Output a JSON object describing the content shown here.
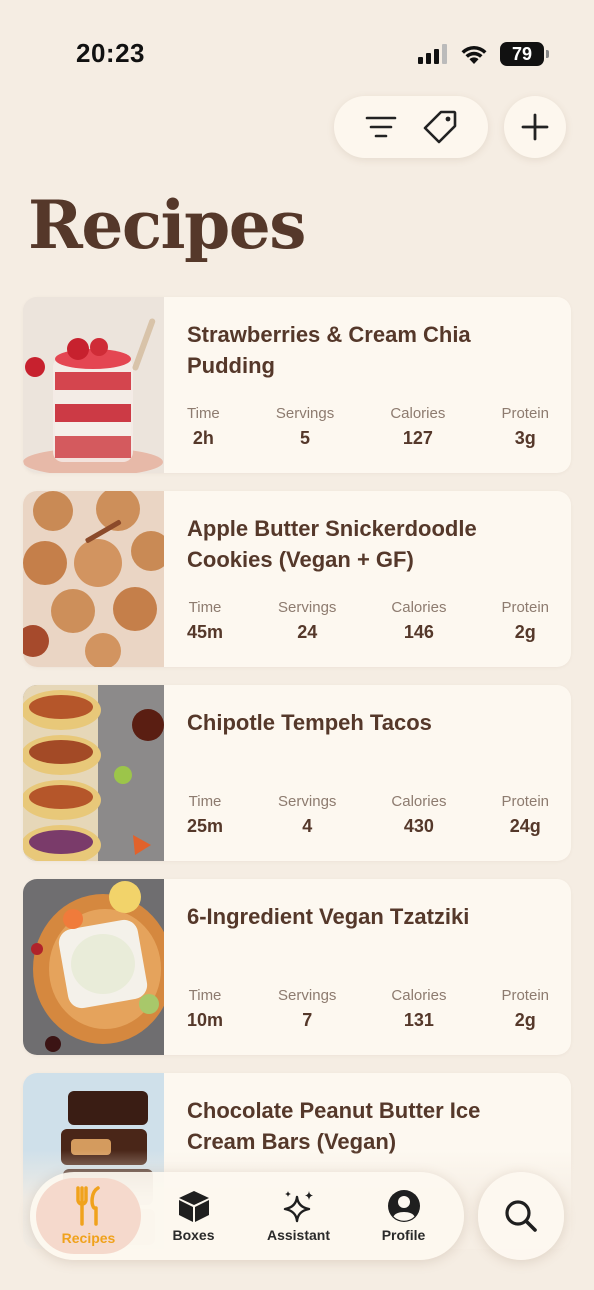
{
  "status_bar": {
    "time": "20:23",
    "battery": "79"
  },
  "page": {
    "title": "Recipes"
  },
  "stat_labels": {
    "time": "Time",
    "servings": "Servings",
    "calories": "Calories",
    "protein": "Protein"
  },
  "recipes": [
    {
      "title": "Strawberries & Cream Chia Pudding",
      "time": "2h",
      "servings": "5",
      "calories": "127",
      "protein": "3g"
    },
    {
      "title": "Apple Butter Snickerdoodle Cookies (Vegan + GF)",
      "time": "45m",
      "servings": "24",
      "calories": "146",
      "protein": "2g"
    },
    {
      "title": "Chipotle Tempeh Tacos",
      "time": "25m",
      "servings": "4",
      "calories": "430",
      "protein": "24g"
    },
    {
      "title": "6-Ingredient Vegan Tzatziki",
      "time": "10m",
      "servings": "7",
      "calories": "131",
      "protein": "2g"
    },
    {
      "title": "Chocolate Peanut Butter Ice Cream Bars (Vegan)",
      "time": "",
      "servings": "",
      "calories": "",
      "protein": ""
    }
  ],
  "tabs": [
    {
      "label": "Recipes",
      "icon": "fork-knife-icon",
      "active": true
    },
    {
      "label": "Boxes",
      "icon": "box-icon",
      "active": false
    },
    {
      "label": "Assistant",
      "icon": "sparkles-icon",
      "active": false
    },
    {
      "label": "Profile",
      "icon": "person-circle-icon",
      "active": false
    }
  ],
  "colors": {
    "background": "#f5ede3",
    "card": "#fdf8f0",
    "title": "#55382a",
    "accent": "#f0a21c"
  }
}
